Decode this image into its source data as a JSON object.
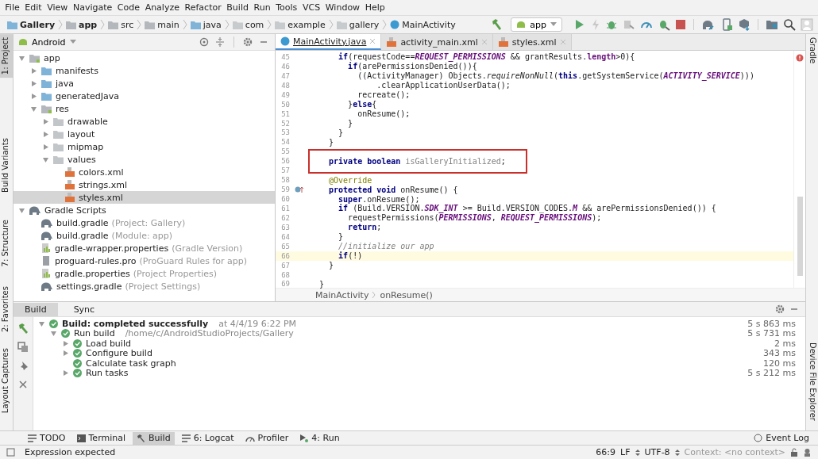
{
  "menu": [
    "File",
    "Edit",
    "View",
    "Navigate",
    "Code",
    "Analyze",
    "Refactor",
    "Build",
    "Run",
    "Tools",
    "VCS",
    "Window",
    "Help"
  ],
  "breadcrumbs": [
    {
      "label": "Gallery",
      "kind": "project"
    },
    {
      "label": "app",
      "kind": "module"
    },
    {
      "label": "src",
      "kind": "folder"
    },
    {
      "label": "main",
      "kind": "folder"
    },
    {
      "label": "java",
      "kind": "source"
    },
    {
      "label": "com",
      "kind": "package"
    },
    {
      "label": "example",
      "kind": "package"
    },
    {
      "label": "gallery",
      "kind": "package"
    },
    {
      "label": "MainActivity",
      "kind": "class"
    }
  ],
  "run_config": {
    "label": "app"
  },
  "left_stripe": [
    {
      "label": "1: Project",
      "selected": true
    },
    {
      "label": "Build Variants",
      "selected": false
    },
    {
      "label": "7: Structure",
      "selected": false
    },
    {
      "label": "2: Favorites",
      "selected": false
    },
    {
      "label": "Layout Captures",
      "selected": false
    }
  ],
  "project_panel": {
    "view": "Android",
    "tree": [
      {
        "label": "app",
        "kind": "module",
        "expanded": true,
        "selected": false,
        "children": [
          {
            "label": "manifests",
            "kind": "folder-source",
            "expanded": false,
            "selected": false
          },
          {
            "label": "java",
            "kind": "folder-source",
            "expanded": false,
            "selected": false
          },
          {
            "label": "generatedJava",
            "kind": "folder-generated",
            "expanded": false,
            "selected": false
          },
          {
            "label": "res",
            "kind": "folder-res",
            "expanded": true,
            "selected": false,
            "children": [
              {
                "label": "drawable",
                "kind": "folder",
                "expanded": false,
                "selected": false
              },
              {
                "label": "layout",
                "kind": "folder",
                "expanded": false,
                "selected": false
              },
              {
                "label": "mipmap",
                "kind": "folder",
                "expanded": false,
                "selected": false
              },
              {
                "label": "values",
                "kind": "folder",
                "expanded": true,
                "selected": false,
                "children": [
                  {
                    "label": "colors.xml",
                    "kind": "xml",
                    "selected": false
                  },
                  {
                    "label": "strings.xml",
                    "kind": "xml",
                    "selected": false
                  },
                  {
                    "label": "styles.xml",
                    "kind": "xml",
                    "selected": true
                  }
                ]
              }
            ]
          }
        ]
      },
      {
        "label": "Gradle Scripts",
        "kind": "gradle-root",
        "expanded": true,
        "selected": false,
        "children": [
          {
            "label": "build.gradle",
            "hint": "(Project: Gallery)",
            "kind": "gradle",
            "selected": false
          },
          {
            "label": "build.gradle",
            "hint": "(Module: app)",
            "kind": "gradle",
            "selected": false
          },
          {
            "label": "gradle-wrapper.properties",
            "hint": "(Gradle Version)",
            "kind": "properties",
            "selected": false
          },
          {
            "label": "proguard-rules.pro",
            "hint": "(ProGuard Rules for app)",
            "kind": "file",
            "selected": false
          },
          {
            "label": "gradle.properties",
            "hint": "(Project Properties)",
            "kind": "properties",
            "selected": false
          },
          {
            "label": "settings.gradle",
            "hint": "(Project Settings)",
            "kind": "gradle",
            "selected": false
          }
        ]
      }
    ]
  },
  "editor_tabs": [
    {
      "label": "MainActivity.java",
      "kind": "java",
      "selected": true
    },
    {
      "label": "activity_main.xml",
      "kind": "xml",
      "selected": false
    },
    {
      "label": "styles.xml",
      "kind": "xml",
      "selected": false
    }
  ],
  "code": [
    {
      "number": "45",
      "tokens": [
        {
          "kind": "kw",
          "text": "    if"
        },
        {
          "kind": "plain",
          "text": "(requestCode=="
        },
        {
          "kind": "const",
          "text": "REQUEST_PERMISSIONS"
        },
        {
          "kind": "plain",
          "text": " && grantResults."
        },
        {
          "kind": "field",
          "text": "length"
        },
        {
          "kind": "plain",
          "text": ">0){"
        }
      ]
    },
    {
      "number": "46",
      "tokens": [
        {
          "kind": "kw",
          "text": "      if"
        },
        {
          "kind": "plain",
          "text": "(arePermissionsDenied()){"
        }
      ]
    },
    {
      "number": "47",
      "tokens": [
        {
          "kind": "plain",
          "text": "        ((ActivityManager) Objects."
        },
        {
          "kind": "static",
          "text": "requireNonNull"
        },
        {
          "kind": "plain",
          "text": "("
        },
        {
          "kind": "kw",
          "text": "this"
        },
        {
          "kind": "plain",
          "text": ".getSystemService("
        },
        {
          "kind": "const",
          "text": "ACTIVITY_SERVICE"
        },
        {
          "kind": "plain",
          "text": ")))"
        }
      ]
    },
    {
      "number": "48",
      "tokens": [
        {
          "kind": "plain",
          "text": "            .clearApplicationUserData();"
        }
      ]
    },
    {
      "number": "49",
      "tokens": [
        {
          "kind": "plain",
          "text": "        recreate();"
        }
      ]
    },
    {
      "number": "50",
      "tokens": [
        {
          "kind": "plain",
          "text": "      }"
        },
        {
          "kind": "kw",
          "text": "else"
        },
        {
          "kind": "plain",
          "text": "{"
        }
      ]
    },
    {
      "number": "51",
      "tokens": [
        {
          "kind": "plain",
          "text": "        onResume();"
        }
      ]
    },
    {
      "number": "52",
      "tokens": [
        {
          "kind": "plain",
          "text": "      }"
        }
      ]
    },
    {
      "number": "53",
      "tokens": [
        {
          "kind": "plain",
          "text": "    }"
        }
      ]
    },
    {
      "number": "54",
      "tokens": [
        {
          "kind": "plain",
          "text": "  }"
        }
      ]
    },
    {
      "number": "55"
    },
    {
      "number": "56",
      "boxed": true,
      "tokens": [
        {
          "kind": "kw",
          "text": "  private boolean "
        },
        {
          "kind": "unused",
          "text": "isGalleryInitialized"
        },
        {
          "kind": "plain",
          "text": ";"
        }
      ]
    },
    {
      "number": "57"
    },
    {
      "number": "58",
      "tokens": [
        {
          "kind": "annot",
          "text": "  @Override"
        }
      ]
    },
    {
      "number": "59",
      "overridden": true,
      "tokens": [
        {
          "kind": "kw",
          "text": "  protected void"
        },
        {
          "kind": "plain",
          "text": " onResume() {"
        }
      ]
    },
    {
      "number": "60",
      "tokens": [
        {
          "kind": "kw",
          "text": "    super"
        },
        {
          "kind": "plain",
          "text": ".onResume();"
        }
      ]
    },
    {
      "number": "61",
      "tokens": [
        {
          "kind": "kw",
          "text": "    if"
        },
        {
          "kind": "plain",
          "text": " (Build.VERSION."
        },
        {
          "kind": "const",
          "text": "SDK_INT"
        },
        {
          "kind": "plain",
          "text": " >= Build.VERSION_CODES."
        },
        {
          "kind": "const",
          "text": "M"
        },
        {
          "kind": "plain",
          "text": " && arePermissionsDenied()) {"
        }
      ]
    },
    {
      "number": "62",
      "tokens": [
        {
          "kind": "plain",
          "text": "      requestPermissions("
        },
        {
          "kind": "const",
          "text": "PERMISSIONS"
        },
        {
          "kind": "plain",
          "text": ", "
        },
        {
          "kind": "const",
          "text": "REQUEST_PERMISSIONS"
        },
        {
          "kind": "plain",
          "text": ");"
        }
      ]
    },
    {
      "number": "63",
      "tokens": [
        {
          "kind": "kw",
          "text": "      return"
        },
        {
          "kind": "plain",
          "text": ";"
        }
      ]
    },
    {
      "number": "64",
      "tokens": [
        {
          "kind": "plain",
          "text": "    }"
        }
      ]
    },
    {
      "number": "65",
      "tokens": [
        {
          "kind": "comment",
          "text": "    //initialize our app"
        }
      ]
    },
    {
      "number": "66",
      "current": true,
      "tokens": [
        {
          "kind": "kw",
          "text": "    if"
        },
        {
          "kind": "plain",
          "text": "(!)"
        }
      ]
    },
    {
      "number": "67",
      "tokens": [
        {
          "kind": "plain",
          "text": "  }"
        }
      ]
    },
    {
      "number": "68"
    },
    {
      "number": "69",
      "tokens": [
        {
          "kind": "plain",
          "text": "}"
        }
      ]
    }
  ],
  "editor_breadcrumbs": [
    "MainActivity",
    "onResume()"
  ],
  "right_stripe": [
    {
      "label": "Gradle"
    },
    {
      "label": "Device File Explorer"
    }
  ],
  "build_window": {
    "tabs": [
      {
        "label": "Build",
        "selected": true
      },
      {
        "label": "Sync",
        "selected": false
      }
    ],
    "tree": [
      {
        "label": "Build: completed successfully",
        "hint": "at 4/4/19 6:22 PM",
        "time": "5 s 863 ms",
        "expanded": true,
        "children": [
          {
            "label": "Run build",
            "hint": "/home/c/AndroidStudioProjects/Gallery",
            "time": "5 s 731 ms",
            "expanded": true,
            "children": [
              {
                "label": "Load build",
                "time": "2 ms",
                "expanded": false
              },
              {
                "label": "Configure build",
                "time": "343 ms",
                "expanded": false
              },
              {
                "label": "Calculate task graph",
                "time": "120 ms"
              },
              {
                "label": "Run tasks",
                "time": "5 s 212 ms",
                "expanded": false
              }
            ]
          }
        ]
      }
    ]
  },
  "tool_buttons": [
    {
      "label": "TODO",
      "kind": "list",
      "selected": false
    },
    {
      "label": "Terminal",
      "kind": "terminal",
      "selected": false
    },
    {
      "label": "Build",
      "kind": "hammer",
      "selected": true
    },
    {
      "label": "6: Logcat",
      "kind": "list",
      "selected": false
    },
    {
      "label": "Profiler",
      "kind": "gauge",
      "selected": false
    },
    {
      "label": "4: Run",
      "kind": "run",
      "selected": false
    }
  ],
  "event_log": "Event Log",
  "status_bar": {
    "message": "Expression expected",
    "position": "66:9",
    "line_separator": "LF",
    "encoding": "UTF-8",
    "context": "Context: <no context>"
  }
}
